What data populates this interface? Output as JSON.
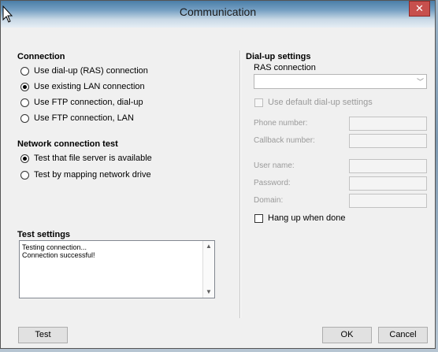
{
  "window": {
    "title": "Communication",
    "close_glyph": "✕"
  },
  "connection": {
    "title": "Connection",
    "options": [
      {
        "label": "Use dial-up (RAS) connection",
        "checked": false
      },
      {
        "label": "Use existing LAN connection",
        "checked": true
      },
      {
        "label": "Use FTP connection, dial-up",
        "checked": false
      },
      {
        "label": "Use FTP connection, LAN",
        "checked": false
      }
    ]
  },
  "network_test": {
    "title": "Network connection test",
    "options": [
      {
        "label": "Test that file server is available",
        "checked": true
      },
      {
        "label": "Test by mapping network drive",
        "checked": false
      }
    ]
  },
  "test_settings": {
    "title": "Test settings",
    "log": [
      "Testing connection...",
      "Connection successful!"
    ]
  },
  "dialup": {
    "title": "Dial-up settings",
    "ras_label": "RAS connection",
    "ras_value": "",
    "use_default_label": "Use default dial-up settings",
    "phone_label": "Phone number:",
    "callback_label": "Callback number:",
    "user_label": "User name:",
    "password_label": "Password:",
    "domain_label": "Domain:",
    "hangup_label": "Hang up when done"
  },
  "buttons": {
    "test": "Test",
    "ok": "OK",
    "cancel": "Cancel"
  }
}
